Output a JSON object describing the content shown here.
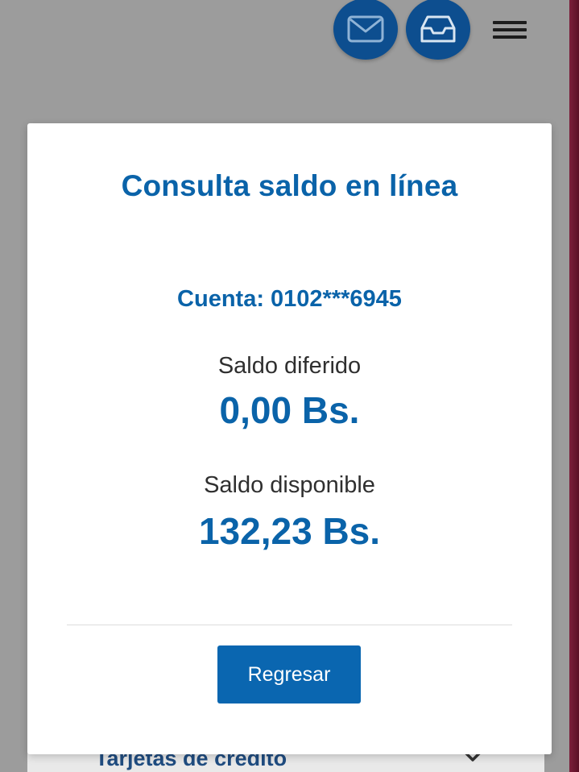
{
  "header": {
    "mail_icon": "mail-icon",
    "inbox_icon": "inbox-icon",
    "menu_icon": "hamburger-menu-icon",
    "accent_color": "#0d4e8f"
  },
  "background": {
    "card_label": "Tarjetas de crédito",
    "chevron_icon": "chevron-down-icon"
  },
  "modal": {
    "title": "Consulta saldo en línea",
    "account": "Cuenta: 0102***6945",
    "deferred_label": "Saldo diferido",
    "deferred_value": "0,00 Bs.",
    "available_label": "Saldo disponible",
    "available_value": "132,23 Bs.",
    "back_button": "Regresar",
    "text_color": "#0a63a9"
  }
}
